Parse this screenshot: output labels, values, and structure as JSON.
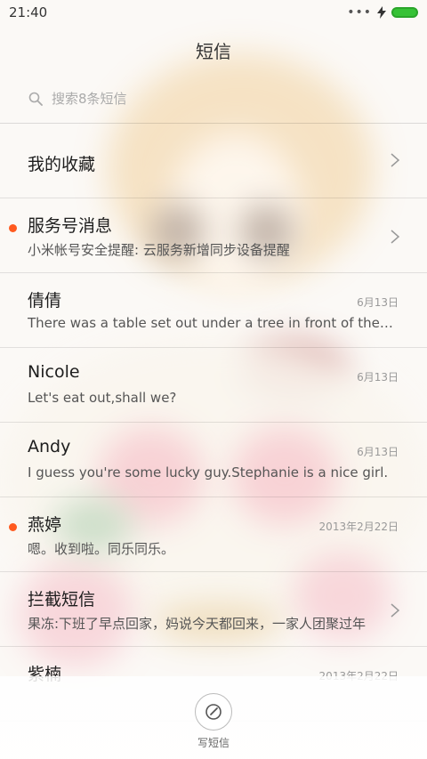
{
  "status": {
    "time": "21:40",
    "more": "•••"
  },
  "header": {
    "title": "短信"
  },
  "search": {
    "placeholder": "搜索8条短信"
  },
  "list": [
    {
      "name": "我的收藏",
      "preview": "",
      "date": "",
      "unread": false,
      "chevron": true
    },
    {
      "name": "服务号消息",
      "preview": "小米帐号安全提醒: 云服务新增同步设备提醒",
      "date": "",
      "unread": true,
      "chevron": true
    },
    {
      "name": "倩倩",
      "preview": "There was a table set out under a tree in front of the house",
      "date": "6月13日",
      "unread": false,
      "chevron": false
    },
    {
      "name": "Nicole",
      "preview": "Let's eat out,shall we?",
      "date": "6月13日",
      "unread": false,
      "chevron": false
    },
    {
      "name": "Andy",
      "preview": "I guess you're some lucky guy.Stephanie is a nice girl.",
      "date": "6月13日",
      "unread": false,
      "chevron": false
    },
    {
      "name": "燕婷",
      "preview": "嗯。收到啦。同乐同乐。",
      "date": "2013年2月22日",
      "unread": true,
      "chevron": false
    },
    {
      "name": "拦截短信",
      "preview": "果冻:下班了早点回家，妈说今天都回来，一家人团聚过年",
      "date": "",
      "unread": false,
      "chevron": true
    },
    {
      "name": "紫楠",
      "preview": "",
      "date": "2013年2月22日",
      "unread": false,
      "chevron": false
    }
  ],
  "compose": {
    "label": "写短信"
  },
  "colors": {
    "unread_dot": "#ff5a1f",
    "battery": "#36c236"
  }
}
